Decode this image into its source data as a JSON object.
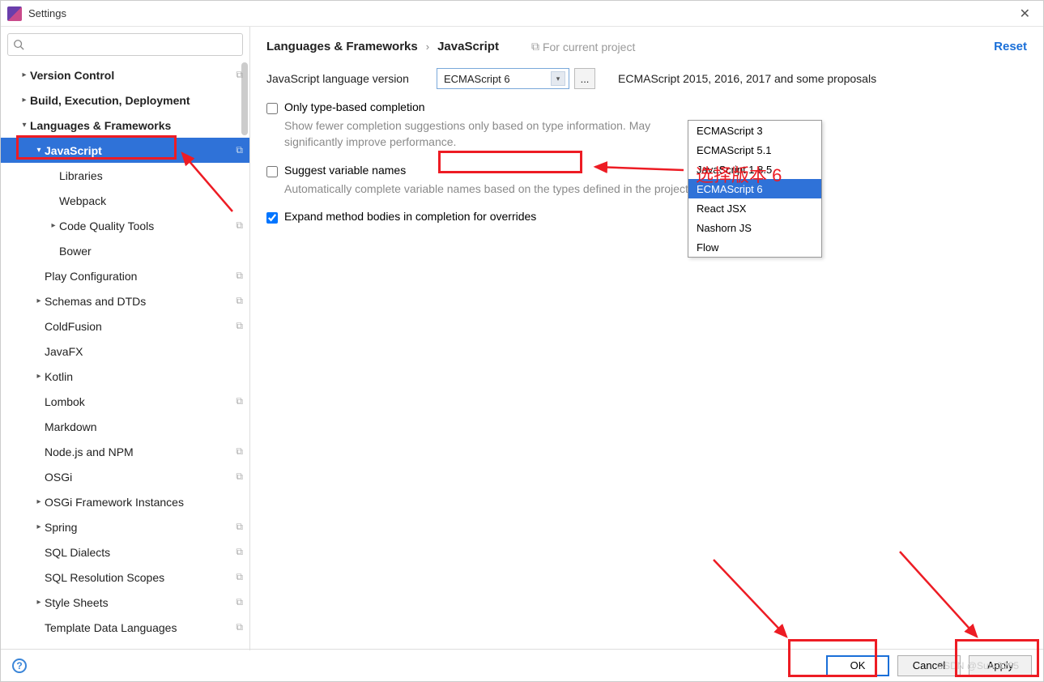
{
  "window": {
    "title": "Settings"
  },
  "search": {
    "placeholder": ""
  },
  "sidebar": {
    "items": [
      {
        "label": "Version Control",
        "level": 0,
        "bold": true,
        "arrow": "▸",
        "copy": true
      },
      {
        "label": "Build, Execution, Deployment",
        "level": 0,
        "bold": true,
        "arrow": "▸"
      },
      {
        "label": "Languages & Frameworks",
        "level": 0,
        "bold": true,
        "arrow": "▾"
      },
      {
        "label": "JavaScript",
        "level": 1,
        "bold": true,
        "arrow": "▾",
        "copy": true,
        "selected": true
      },
      {
        "label": "Libraries",
        "level": 2
      },
      {
        "label": "Webpack",
        "level": 2
      },
      {
        "label": "Code Quality Tools",
        "level": 2,
        "arrow": "▸",
        "copy": true
      },
      {
        "label": "Bower",
        "level": 2
      },
      {
        "label": "Play Configuration",
        "level": 1,
        "copy": true
      },
      {
        "label": "Schemas and DTDs",
        "level": 1,
        "arrow": "▸",
        "copy": true
      },
      {
        "label": "ColdFusion",
        "level": 1,
        "copy": true
      },
      {
        "label": "JavaFX",
        "level": 1
      },
      {
        "label": "Kotlin",
        "level": 1,
        "arrow": "▸"
      },
      {
        "label": "Lombok",
        "level": 1,
        "copy": true
      },
      {
        "label": "Markdown",
        "level": 1
      },
      {
        "label": "Node.js and NPM",
        "level": 1,
        "copy": true
      },
      {
        "label": "OSGi",
        "level": 1,
        "copy": true
      },
      {
        "label": "OSGi Framework Instances",
        "level": 1,
        "arrow": "▸"
      },
      {
        "label": "Spring",
        "level": 1,
        "arrow": "▸",
        "copy": true
      },
      {
        "label": "SQL Dialects",
        "level": 1,
        "copy": true
      },
      {
        "label": "SQL Resolution Scopes",
        "level": 1,
        "copy": true
      },
      {
        "label": "Style Sheets",
        "level": 1,
        "arrow": "▸",
        "copy": true
      },
      {
        "label": "Template Data Languages",
        "level": 1,
        "copy": true
      }
    ]
  },
  "breadcrumb": {
    "crumb1": "Languages & Frameworks",
    "sep": "›",
    "crumb2": "JavaScript",
    "hint": "For current project",
    "reset": "Reset"
  },
  "main": {
    "lang_label": "JavaScript language version",
    "lang_selected": "ECMAScript 6",
    "lang_desc": "ECMAScript 2015, 2016, 2017 and some proposals",
    "more": "...",
    "check1_label": "Only type-based completion",
    "check1_sub": "Show fewer completion suggestions only based on type information. May significantly improve performance.",
    "check2_label": "Suggest variable names",
    "check2_sub": "Automatically complete variable names based on the types defined in the project",
    "check3_label": "Expand method bodies in completion for overrides",
    "dropdown": {
      "options": [
        "ECMAScript 3",
        "ECMAScript 5.1",
        "JavaScript 1.8.5",
        "ECMAScript 6",
        "React JSX",
        "Nashorn JS",
        "Flow"
      ],
      "selected_index": 3
    }
  },
  "footer": {
    "ok": "OK",
    "cancel": "Cancel",
    "apply": "Apply"
  },
  "annotations": {
    "select_version": "选择版本 6"
  },
  "watermark": "CSDN @Sun-3285"
}
